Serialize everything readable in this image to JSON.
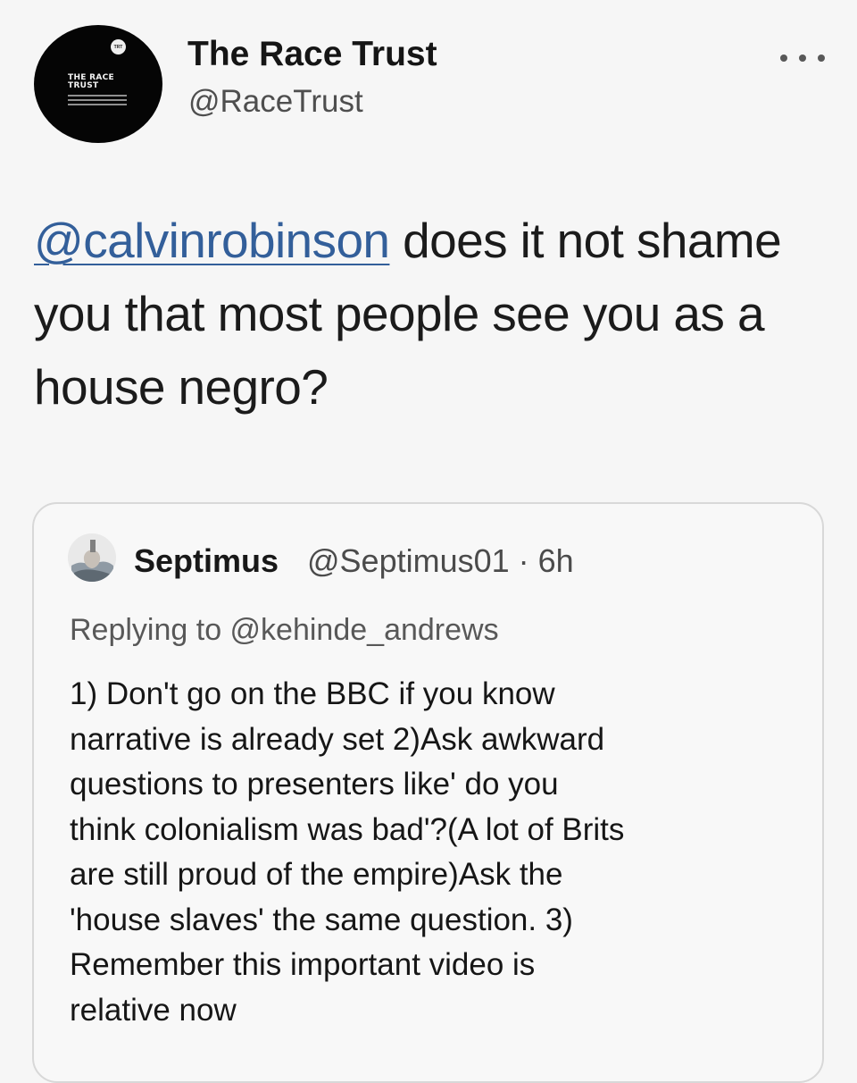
{
  "tweet": {
    "avatar": {
      "badge_text": "TRT",
      "logo_lines": [
        "THE RACE",
        "TRUST"
      ]
    },
    "display_name": "The Race Trust",
    "handle": "@RaceTrust",
    "more_icon": "more-horizontal-icon",
    "text": {
      "mention": "@calvinrobinson",
      "rest": "does it not shame you that most people see you as a house negro?"
    }
  },
  "quote": {
    "name": "Septimus",
    "handle_meta": "@Septimus01 · 6h",
    "reply_context": "Replying to @kehinde_andrews",
    "body_lines": [
      "1) Don't go on the BBC if you know",
      "narrative is already set 2)Ask awkward",
      "questions to presenters like' do you",
      "think colonialism was bad'?(A lot of Brits",
      "are still proud of the empire)Ask the",
      "'house slaves' the same question. 3)",
      "Remember this important video is",
      "relative now"
    ]
  },
  "colors": {
    "background": "#f6f6f6",
    "link": "#335f9a",
    "avatar": "#050505",
    "secondary_text": "#4e4e4e"
  }
}
